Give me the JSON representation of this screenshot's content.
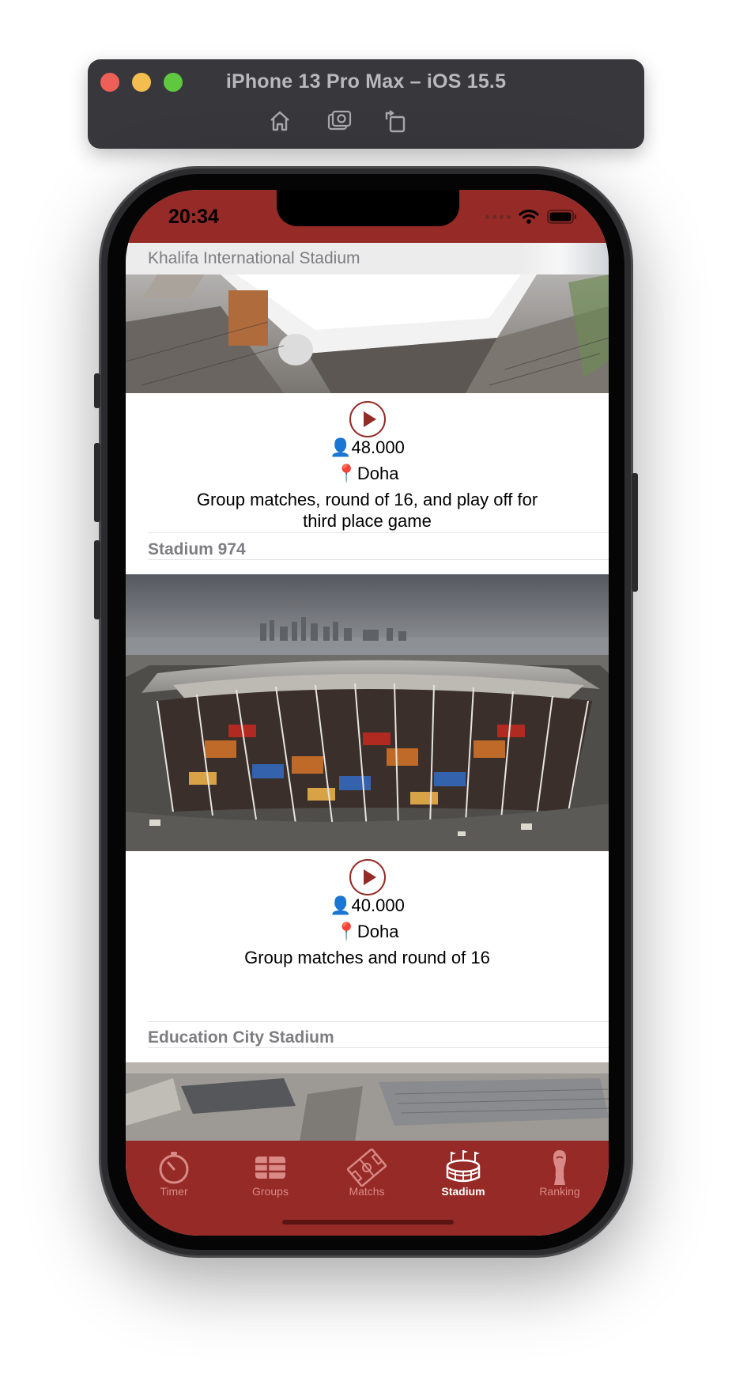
{
  "simulator": {
    "title": "iPhone 13 Pro Max – iOS 15.5",
    "tools": [
      "home-icon",
      "screenshot-icon",
      "rotate-icon"
    ]
  },
  "status_bar": {
    "time": "20:34"
  },
  "stadiums": [
    {
      "name": "Khalifa International Stadium",
      "capacity": "48.000",
      "city": "Doha",
      "description": "Group matches, round of 16, and play off for third place game"
    },
    {
      "name": "Stadium 974",
      "capacity": "40.000",
      "city": "Doha",
      "description": "Group matches and round of 16"
    },
    {
      "name": "Education City Stadium"
    }
  ],
  "icons": {
    "capacity": "👤",
    "location": "📍"
  },
  "tabs": [
    {
      "label": "Timer",
      "icon": "stopwatch-icon",
      "active": false
    },
    {
      "label": "Groups",
      "icon": "grid-icon",
      "active": false
    },
    {
      "label": "Matchs",
      "icon": "pitch-icon",
      "active": false
    },
    {
      "label": "Stadium",
      "icon": "stadium-icon",
      "active": true
    },
    {
      "label": "Ranking",
      "icon": "trophy-icon",
      "active": false
    }
  ],
  "colors": {
    "brand": "#952a26",
    "tab_inactive": "#d98a86",
    "tab_active": "#ffffff"
  }
}
